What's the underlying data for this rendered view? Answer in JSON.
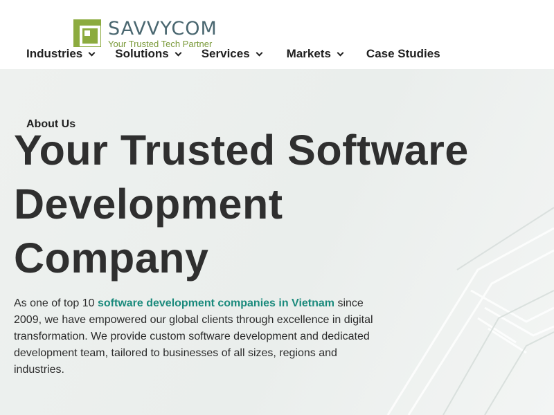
{
  "brand": {
    "name": "SAVVYCOM",
    "tagline": "Your Trusted Tech Partner",
    "mark_color": "#8cab3f"
  },
  "nav": {
    "items": [
      {
        "label": "Industries",
        "has_dropdown": true
      },
      {
        "label": "Solutions",
        "has_dropdown": true
      },
      {
        "label": "Services",
        "has_dropdown": true
      },
      {
        "label": "Markets",
        "has_dropdown": true
      },
      {
        "label": "Case Studies",
        "has_dropdown": false
      }
    ]
  },
  "hero": {
    "eyebrow": "About Us",
    "title_line1": "Your Trusted Software",
    "title_line2": "Development",
    "title_line3": "Company",
    "desc_prefix": "As one of top 10 ",
    "desc_link": "software development companies in Vietnam",
    "desc_suffix": " since 2009, we have empowered our global clients through excellence in digital transformation. We provide custom software development and dedicated development team, tailored to businesses of all sizes, regions and industries.",
    "link_color": "#1a8a7c"
  }
}
